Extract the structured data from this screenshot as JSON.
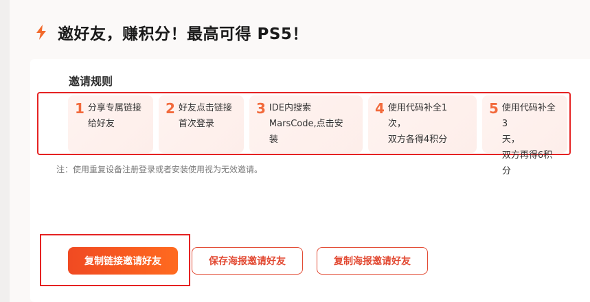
{
  "header": {
    "icon": "lightning-bolt-icon",
    "accent": "#f26a2c",
    "title": "邀好友，赚积分！最高可得 PS5！"
  },
  "rules": {
    "title": "邀请规则",
    "steps": [
      {
        "num": "1",
        "text": "分享专属链接\n给好友"
      },
      {
        "num": "2",
        "text": "好友点击链接\n首次登录"
      },
      {
        "num": "3",
        "text": "IDE内搜索\nMarsCode,点击安\n装"
      },
      {
        "num": "4",
        "text": "使用代码补全1\n次，\n双方各得4积分"
      },
      {
        "num": "5",
        "text": "使用代码补全3\n天，\n双方再得6积分"
      }
    ],
    "note": "注：使用重复设备注册登录或者安装使用视为无效邀请。"
  },
  "actions": {
    "copy_link": "复制链接邀请好友",
    "save_poster": "保存海报邀请好友",
    "copy_poster": "复制海报邀请好友"
  },
  "colors": {
    "primary": "#f04a22",
    "highlight_frame": "#e52222",
    "step_bg": "#fff1ee"
  }
}
